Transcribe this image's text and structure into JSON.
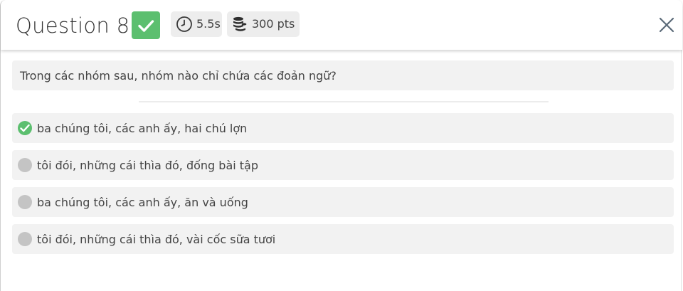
{
  "header": {
    "title": "Question 8",
    "status_icon": "check-icon",
    "time_icon": "clock-icon",
    "time_label": "5.5s",
    "points_icon": "coins-icon",
    "points_label": "300 pts",
    "close_icon": "close-icon"
  },
  "question": {
    "text": "Trong các nhóm sau, nhóm nào chỉ chứa các đoản ngữ?"
  },
  "options": [
    {
      "label": "ba chúng tôi, các anh ấy, hai chú lợn",
      "correct": true
    },
    {
      "label": "tôi đói, những cái thìa đó, đống bài tập",
      "correct": false
    },
    {
      "label": "ba chúng tôi, các anh ấy, ăn và uống",
      "correct": false
    },
    {
      "label": "tôi đói, những cái thìa đó, vài cốc sữa tươi",
      "correct": false
    }
  ],
  "colors": {
    "correct": "#5cbf6f",
    "neutral_marker": "#c4c4c4",
    "option_bg": "#f2f2f2",
    "pill_bg": "#ededed",
    "text": "#444444"
  }
}
